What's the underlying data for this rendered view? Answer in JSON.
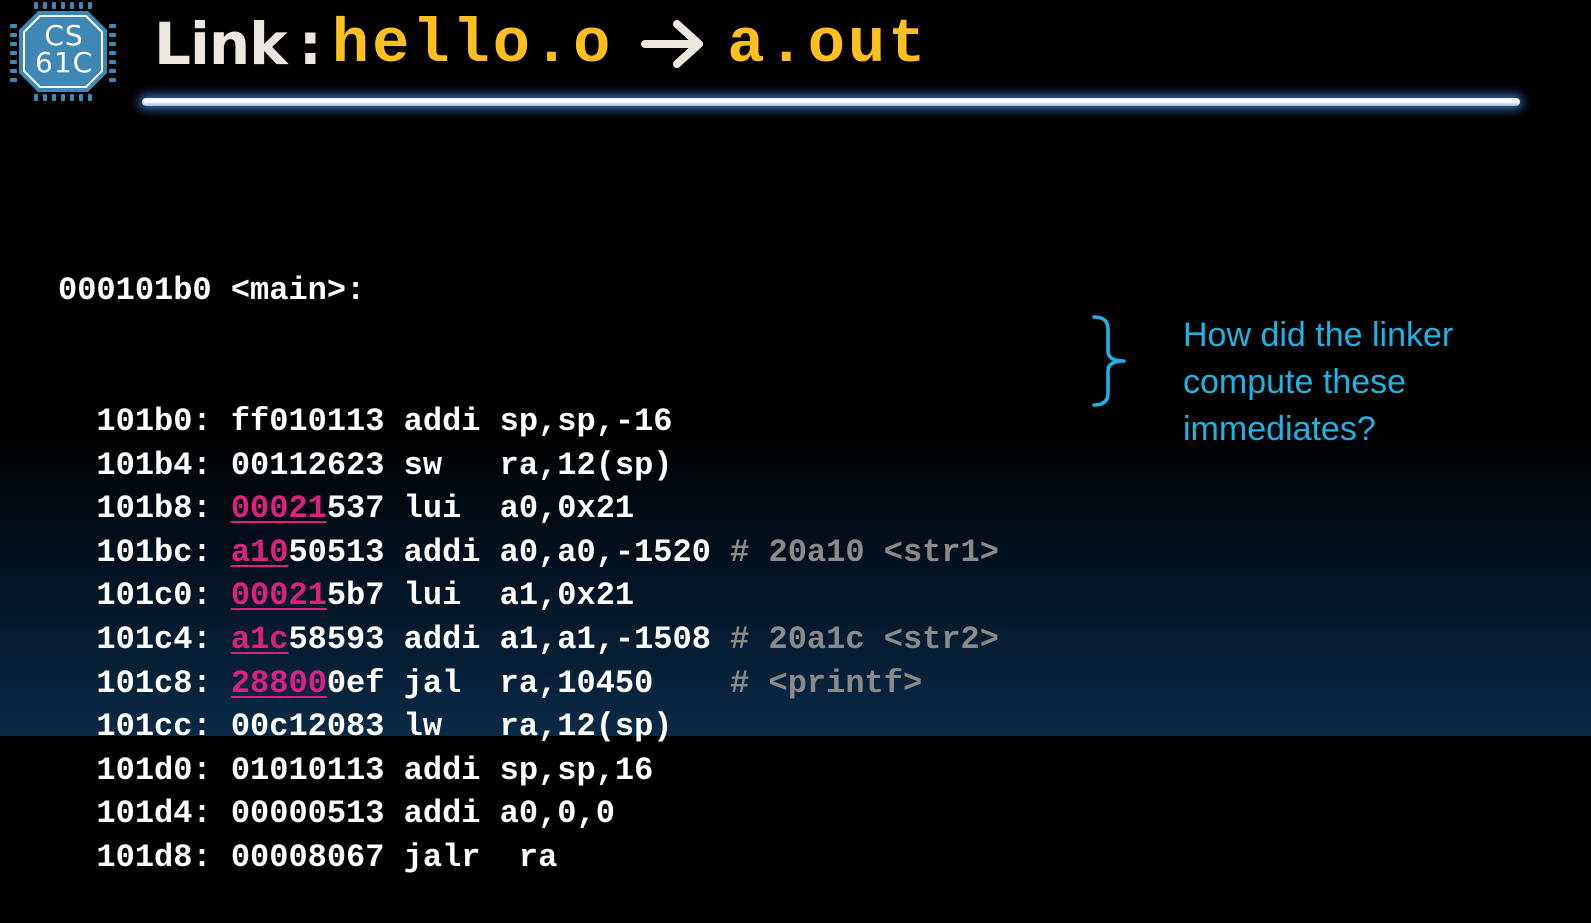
{
  "logo": {
    "line1": "CS",
    "line2": "61C",
    "color": "#3f87b4"
  },
  "title": {
    "word": "Link",
    "colon": ":",
    "source": "hello.o",
    "target": "a.out",
    "arrow_icon": "arrow-right-icon",
    "colors": {
      "word": "#ece7df",
      "files": "#ffbf1f",
      "rule_glow": "#4682dc"
    }
  },
  "code": {
    "header": "000101b0 <main>:",
    "lines": [
      {
        "addr": "101b0:",
        "hex_hl": "",
        "hex_rest": "ff010113",
        "asm": "addi sp,sp,-16",
        "comment": ""
      },
      {
        "addr": "101b4:",
        "hex_hl": "",
        "hex_rest": "00112623",
        "asm": "sw   ra,12(sp)",
        "comment": ""
      },
      {
        "addr": "101b8:",
        "hex_hl": "00021",
        "hex_rest": "537",
        "asm": "lui  a0,0x21",
        "comment": ""
      },
      {
        "addr": "101bc:",
        "hex_hl": "a10",
        "hex_rest": "50513",
        "asm": "addi a0,a0,-1520",
        "comment": "# 20a10 <str1>"
      },
      {
        "addr": "101c0:",
        "hex_hl": "00021",
        "hex_rest": "5b7",
        "asm": "lui  a1,0x21",
        "comment": ""
      },
      {
        "addr": "101c4:",
        "hex_hl": "a1c",
        "hex_rest": "58593",
        "asm": "addi a1,a1,-1508",
        "comment": "# 20a1c <str2>"
      },
      {
        "addr": "101c8:",
        "hex_hl": "28800",
        "hex_rest": "0ef",
        "asm": "jal  ra,10450",
        "comment": "   # <printf>"
      },
      {
        "addr": "101cc:",
        "hex_hl": "",
        "hex_rest": "00c12083",
        "asm": "lw   ra,12(sp)",
        "comment": ""
      },
      {
        "addr": "101d0:",
        "hex_hl": "",
        "hex_rest": "01010113",
        "asm": "addi sp,sp,16",
        "comment": ""
      },
      {
        "addr": "101d4:",
        "hex_hl": "",
        "hex_rest": "00000513",
        "asm": "addi a0,0,0",
        "comment": ""
      },
      {
        "addr": "101d8:",
        "hex_hl": "",
        "hex_rest": "00008067",
        "asm": "jalr  ra",
        "comment": ""
      }
    ],
    "colors": {
      "text": "#ffffff",
      "highlight": "#e0207e",
      "comment": "#8a8a8a"
    }
  },
  "annotation": {
    "brace_icon": "right-curly-brace-icon",
    "line1": "How did the linker",
    "line2": "compute these",
    "line3": "immediates?",
    "color": "#1fb2e4"
  }
}
